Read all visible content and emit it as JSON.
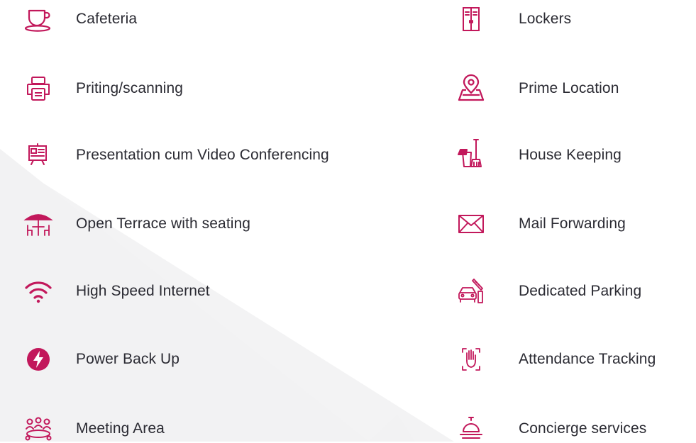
{
  "accent_color": "#C2185B",
  "amenities_left": [
    {
      "label": "Cafeteria",
      "icon": "coffee-cup-icon"
    },
    {
      "label": "Priting/scanning",
      "icon": "printer-icon"
    },
    {
      "label": "Presentation cum Video Conferencing",
      "icon": "presentation-board-icon"
    },
    {
      "label": "Open Terrace with seating",
      "icon": "terrace-umbrella-table-icon"
    },
    {
      "label": "High Speed Internet",
      "icon": "wifi-icon"
    },
    {
      "label": "Power Back Up",
      "icon": "power-bolt-icon"
    },
    {
      "label": "Meeting Area",
      "icon": "meeting-people-icon"
    }
  ],
  "amenities_right": [
    {
      "label": "Lockers",
      "icon": "locker-icon"
    },
    {
      "label": "Prime Location",
      "icon": "location-pin-map-icon"
    },
    {
      "label": "House Keeping",
      "icon": "housekeeping-bucket-mop-icon"
    },
    {
      "label": "Mail Forwarding",
      "icon": "envelope-icon"
    },
    {
      "label": "Dedicated Parking",
      "icon": "parking-car-barrier-icon"
    },
    {
      "label": "Attendance Tracking",
      "icon": "hand-scan-icon"
    },
    {
      "label": "Concierge services",
      "icon": "service-bell-icon"
    }
  ]
}
